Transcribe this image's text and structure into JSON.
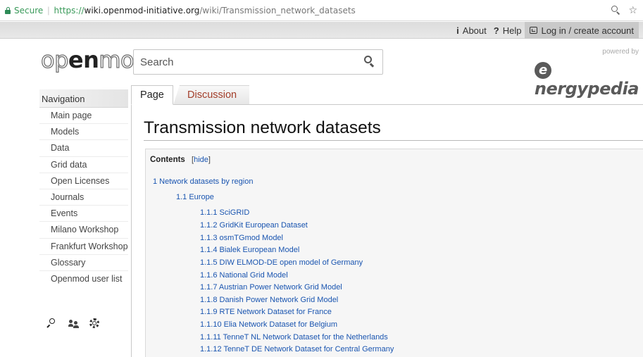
{
  "browser": {
    "secure_label": "Secure",
    "url_proto": "https://",
    "url_host": "wiki.openmod-initiative.org",
    "url_path": "/wiki/Transmission_network_datasets"
  },
  "personal": {
    "about": "About",
    "help": "Help",
    "login": "Log in / create account"
  },
  "logo": {
    "open": "op",
    "en": "en",
    "mod": "mod"
  },
  "search": {
    "placeholder": "Search"
  },
  "brand": {
    "powered_by": "powered by",
    "name": "nergypedia",
    "initial": "e"
  },
  "sidebar": {
    "header": "Navigation",
    "items": [
      "Main page",
      "Models",
      "Data",
      "Grid data",
      "Open Licenses",
      "Journals",
      "Events",
      "Milano Workshop",
      "Frankfurt Workshop",
      "Glossary",
      "Openmod user list"
    ]
  },
  "tabs": {
    "page": "Page",
    "discussion": "Discussion"
  },
  "page": {
    "title": "Transmission network datasets"
  },
  "toc": {
    "title": "Contents",
    "hide_open": "[",
    "hide_label": "hide",
    "hide_close": "]",
    "entries": [
      "1 Network datasets by region",
      "1.1 Europe",
      "1.1.1 SciGRID",
      "1.1.2 GridKit European Dataset",
      "1.1.3 osmTGmod Model",
      "1.1.4 Bialek European Model",
      "1.1.5 DIW ELMOD-DE open model of Germany",
      "1.1.6 National Grid Model",
      "1.1.7 Austrian Power Network Grid Model",
      "1.1.8 Danish Power Network Grid Model",
      "1.1.9 RTE Network Dataset for France",
      "1.1.10 Elia Network Dataset for Belgium",
      "1.1.11 TenneT NL Network Dataset for the Netherlands",
      "1.1.12 TenneT DE Network Dataset for Central Germany"
    ]
  }
}
